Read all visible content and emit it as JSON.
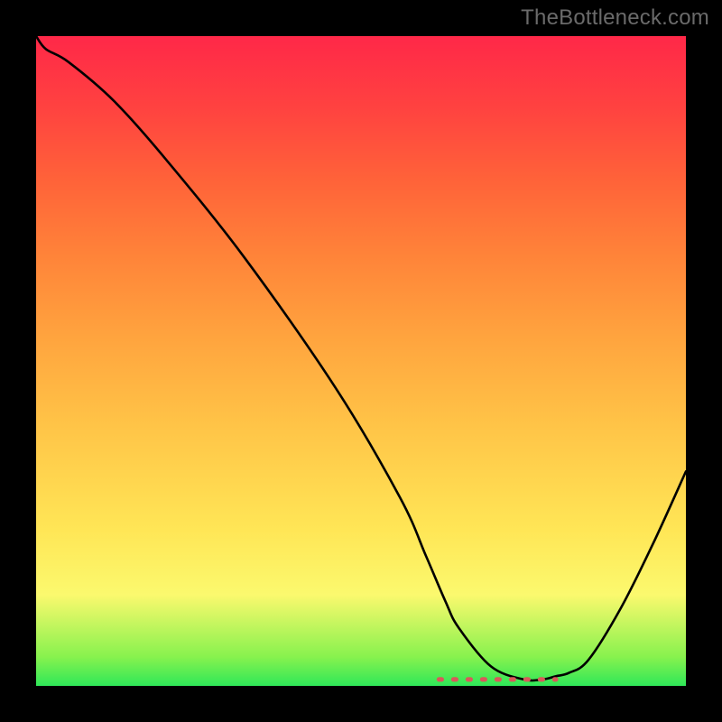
{
  "watermark": "TheBottleneck.com",
  "colors": {
    "page_bg": "#000000",
    "watermark": "#6a6a6a",
    "curve": "#000000",
    "dash": "#d85a5a"
  },
  "chart_data": {
    "type": "line",
    "title": "",
    "xlabel": "",
    "ylabel": "",
    "xlim": [
      0,
      100
    ],
    "ylim": [
      0,
      100
    ],
    "grid": false,
    "legend": false,
    "series": [
      {
        "name": "bottleneck-curve",
        "x": [
          0,
          1.5,
          5,
          12,
          20,
          32,
          46,
          56,
          60,
          63,
          65,
          70,
          75,
          78,
          80,
          82,
          85,
          90,
          95,
          100
        ],
        "values": [
          100,
          98,
          96,
          90,
          81,
          66,
          46,
          29,
          20,
          13,
          9,
          3,
          1,
          1,
          1.5,
          2,
          4,
          12,
          22,
          33
        ]
      }
    ],
    "annotations": [
      {
        "name": "optimum-dash",
        "style": "dashed",
        "y": 1,
        "x_start": 62,
        "x_end": 80
      }
    ]
  }
}
